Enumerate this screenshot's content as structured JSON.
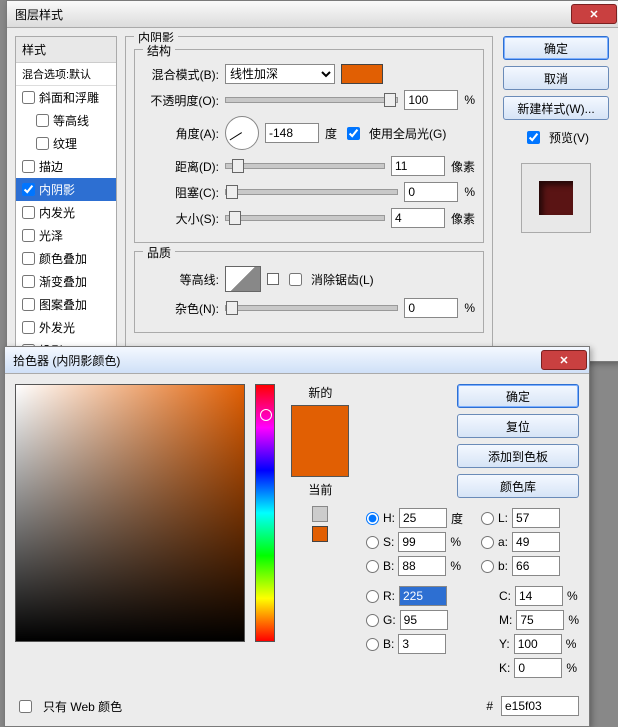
{
  "layerStyle": {
    "title": "图层样式",
    "stylesHeader": "样式",
    "blendDefaults": "混合选项:默认",
    "effects": [
      {
        "label": "斜面和浮雕",
        "checked": false,
        "selected": false
      },
      {
        "label": "等高线",
        "checked": false,
        "selected": false,
        "indent": true
      },
      {
        "label": "纹理",
        "checked": false,
        "selected": false,
        "indent": true
      },
      {
        "label": "描边",
        "checked": false,
        "selected": false
      },
      {
        "label": "内阴影",
        "checked": true,
        "selected": true
      },
      {
        "label": "内发光",
        "checked": false,
        "selected": false
      },
      {
        "label": "光泽",
        "checked": false,
        "selected": false
      },
      {
        "label": "颜色叠加",
        "checked": false,
        "selected": false
      },
      {
        "label": "渐变叠加",
        "checked": false,
        "selected": false
      },
      {
        "label": "图案叠加",
        "checked": false,
        "selected": false
      },
      {
        "label": "外发光",
        "checked": false,
        "selected": false
      },
      {
        "label": "投影",
        "checked": false,
        "selected": false
      }
    ],
    "panelTitle": "内阴影",
    "structureTitle": "结构",
    "blendModeLabel": "混合模式(B):",
    "blendModeValue": "线性加深",
    "swatchColor": "#e15f03",
    "opacityLabel": "不透明度(O):",
    "opacityValue": "100",
    "pct": "%",
    "angleLabel": "角度(A):",
    "angleValue": "-148",
    "deg": "度",
    "globalLight": "使用全局光(G)",
    "distanceLabel": "距离(D):",
    "distanceValue": "11",
    "px": "像素",
    "chokeLabel": "阻塞(C):",
    "chokeValue": "0",
    "sizeLabel": "大小(S):",
    "sizeValue": "4",
    "qualityTitle": "品质",
    "contourLabel": "等高线:",
    "antiAlias": "消除锯齿(L)",
    "noiseLabel": "杂色(N):",
    "noiseValue": "0",
    "ok": "确定",
    "cancel": "取消",
    "newStyle": "新建样式(W)...",
    "preview": "预览(V)"
  },
  "picker": {
    "title": "拾色器 (内阴影颜色)",
    "newLabel": "新的",
    "currentLabel": "当前",
    "ok": "确定",
    "reset": "复位",
    "addSwatch": "添加到色板",
    "libraries": "颜色库",
    "H": {
      "l": "H:",
      "v": "25",
      "u": "度"
    },
    "S": {
      "l": "S:",
      "v": "99",
      "u": "%"
    },
    "Bv": {
      "l": "B:",
      "v": "88",
      "u": "%"
    },
    "R": {
      "l": "R:",
      "v": "225"
    },
    "G": {
      "l": "G:",
      "v": "95"
    },
    "Bc": {
      "l": "B:",
      "v": "3"
    },
    "L": {
      "l": "L:",
      "v": "57"
    },
    "a": {
      "l": "a:",
      "v": "49"
    },
    "b": {
      "l": "b:",
      "v": "66"
    },
    "C": {
      "l": "C:",
      "v": "14",
      "u": "%"
    },
    "M": {
      "l": "M:",
      "v": "75",
      "u": "%"
    },
    "Y": {
      "l": "Y:",
      "v": "100",
      "u": "%"
    },
    "K": {
      "l": "K:",
      "v": "0",
      "u": "%"
    },
    "webOnly": "只有 Web 颜色",
    "hexLabel": "#",
    "hex": "e15f03"
  }
}
